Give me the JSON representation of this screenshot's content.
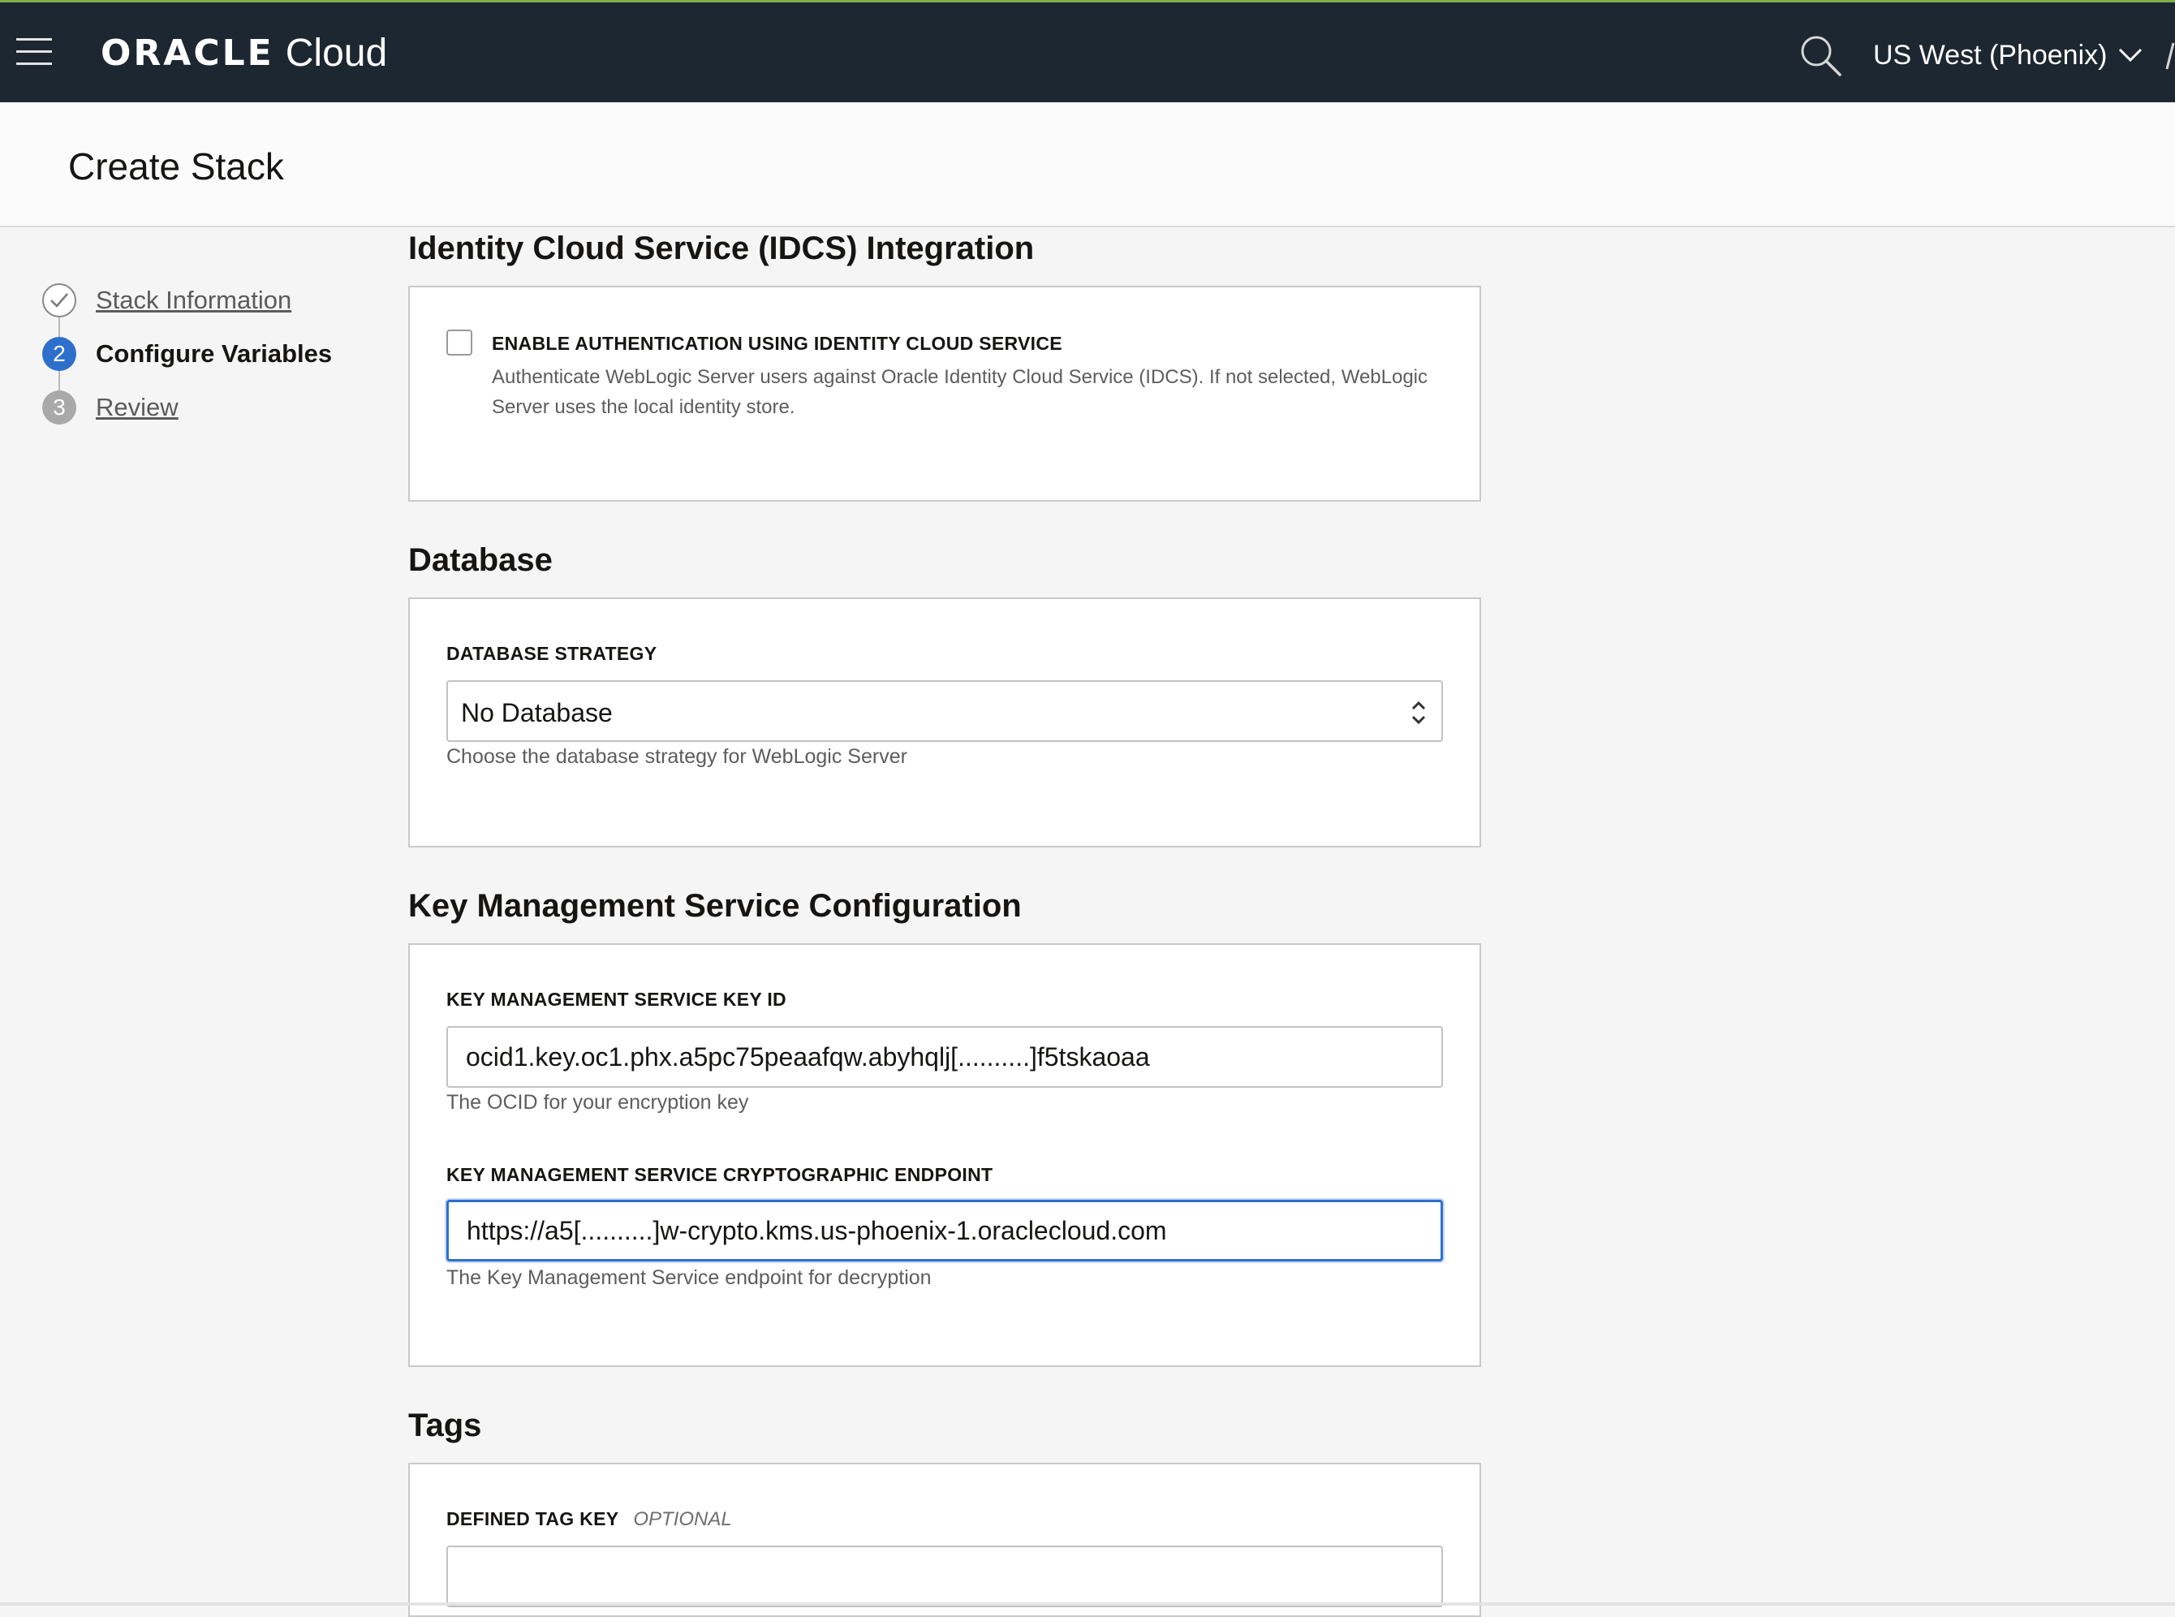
{
  "topbar": {
    "menu_icon": "hamburger-menu-icon",
    "brand": "ORACLE",
    "product": "Cloud",
    "search_icon": "search-icon",
    "region": "US West (Phoenix)",
    "region_icon": "chevron-down-icon",
    "bg_color": "#1d2731"
  },
  "page": {
    "title": "Create Stack"
  },
  "wizard": {
    "steps": [
      {
        "number": "",
        "label": "Stack Information",
        "state": "completed",
        "icon": "check-circle-icon"
      },
      {
        "number": "2",
        "label": "Configure Variables",
        "state": "current"
      },
      {
        "number": "3",
        "label": "Review",
        "state": "upcoming"
      }
    ],
    "current_color": "#2f6fcc"
  },
  "idcs": {
    "title": "Identity Cloud Service (IDCS) Integration",
    "checkbox_label": "ENABLE AUTHENTICATION USING IDENTITY CLOUD SERVICE",
    "checkbox_checked": false,
    "description": "Authenticate WebLogic Server users against Oracle Identity Cloud Service (IDCS). If not selected, WebLogic Server uses the local identity store."
  },
  "database": {
    "title": "Database",
    "strategy_label": "DATABASE STRATEGY",
    "strategy_value": "No Database",
    "strategy_help": "Choose the database strategy for WebLogic Server"
  },
  "kms": {
    "title": "Key Management Service Configuration",
    "key_id_label": "KEY MANAGEMENT SERVICE KEY ID",
    "key_id_value": "ocid1.key.oc1.phx.a5pc75peaafqw.abyhqlj[..........]f5tskaoaa",
    "key_id_help": "The OCID for your encryption key",
    "endpoint_label": "KEY MANAGEMENT SERVICE CRYPTOGRAPHIC ENDPOINT",
    "endpoint_value": "https://a5[..........]w-crypto.kms.us-phoenix-1.oraclecloud.com",
    "endpoint_help": "The Key Management Service endpoint for decryption",
    "focus_color": "#2f6fcc"
  },
  "tags": {
    "title": "Tags",
    "key_label": "DEFINED TAG KEY",
    "key_optional": "OPTIONAL",
    "key_value": ""
  }
}
